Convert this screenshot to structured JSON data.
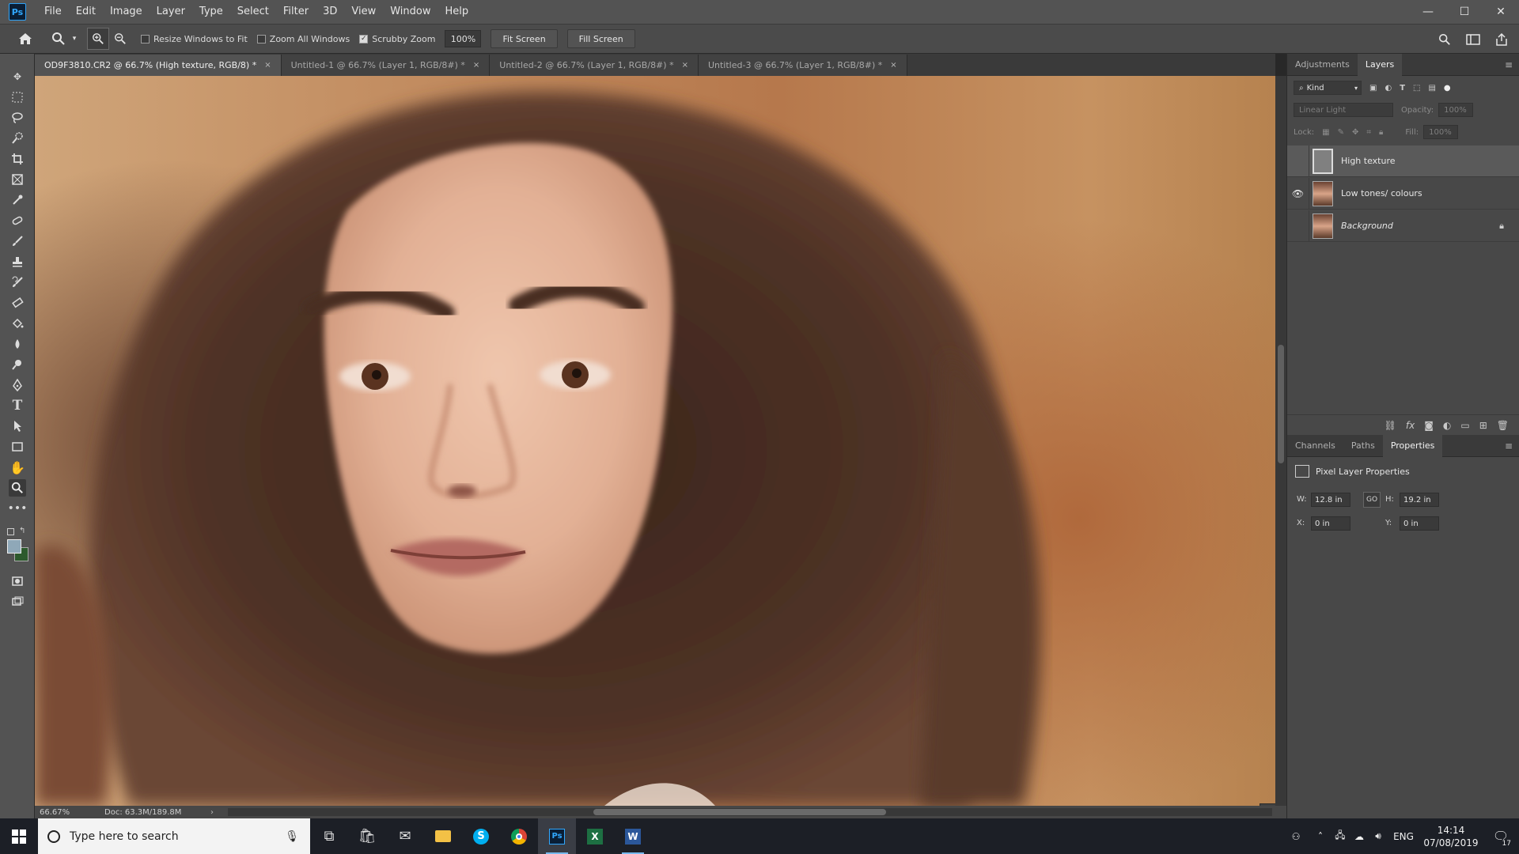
{
  "app": {
    "logo": "Ps"
  },
  "menu": [
    "File",
    "Edit",
    "Image",
    "Layer",
    "Type",
    "Select",
    "Filter",
    "3D",
    "View",
    "Window",
    "Help"
  ],
  "window_controls": {
    "minimize": "—",
    "maximize": "☐",
    "close": "✕"
  },
  "options": {
    "resize_windows_label": "Resize Windows to Fit",
    "resize_windows_checked": false,
    "zoom_all_label": "Zoom All Windows",
    "zoom_all_checked": false,
    "scrubby_label": "Scrubby Zoom",
    "scrubby_checked": true,
    "zoom_value": "100%",
    "fit_screen": "Fit Screen",
    "fill_screen": "Fill Screen"
  },
  "tabs": [
    {
      "title": "OD9F3810.CR2 @ 66.7% (High texture, RGB/8) *",
      "active": true
    },
    {
      "title": "Untitled-1 @ 66.7% (Layer 1, RGB/8#) *",
      "active": false
    },
    {
      "title": "Untitled-2 @ 66.7% (Layer 1, RGB/8#) *",
      "active": false
    },
    {
      "title": "Untitled-3 @ 66.7% (Layer 1, RGB/8#) *",
      "active": false
    }
  ],
  "tab_close": "×",
  "status": {
    "zoom": "66.67%",
    "doc": "Doc: 63.3M/189.8M"
  },
  "layers_panel": {
    "tabs": [
      "Adjustments",
      "Layers"
    ],
    "active_tab": "Layers",
    "filter": "Kind",
    "blend_mode": "Linear Light",
    "opacity_label": "Opacity:",
    "opacity_value": "100%",
    "lock_label": "Lock:",
    "fill_label": "Fill:",
    "fill_value": "100%",
    "layers": [
      {
        "name": "High texture",
        "visible": false,
        "selected": true,
        "italic": false,
        "locked": false
      },
      {
        "name": "Low tones/ colours",
        "visible": true,
        "selected": false,
        "italic": false,
        "locked": false
      },
      {
        "name": "Background",
        "visible": false,
        "selected": false,
        "italic": true,
        "locked": true
      }
    ]
  },
  "properties_panel": {
    "tabs": [
      "Channels",
      "Paths",
      "Properties"
    ],
    "active_tab": "Properties",
    "heading": "Pixel Layer Properties",
    "w_label": "W:",
    "w_value": "12.8 in",
    "h_label": "H:",
    "h_value": "19.2 in",
    "link_label": "GO",
    "x_label": "X:",
    "x_value": "0 in",
    "y_label": "Y:",
    "y_value": "0 in"
  },
  "taskbar": {
    "search_placeholder": "Type here to search",
    "language": "ENG",
    "time": "14:14",
    "date": "07/08/2019",
    "notification_count": "17"
  },
  "colors": {
    "accent": "#31a8ff",
    "foreground_swatch": "#8fa8b8",
    "background_swatch": "#2d5a2d"
  }
}
